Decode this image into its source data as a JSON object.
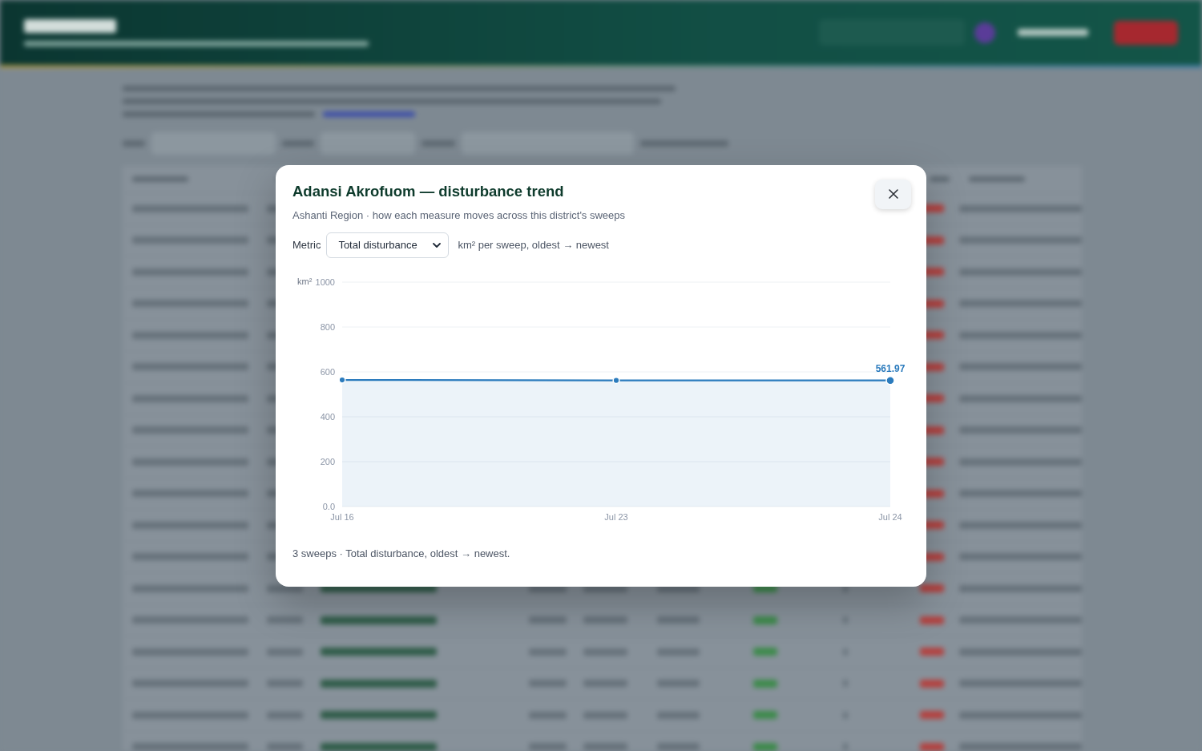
{
  "modal": {
    "title": "Adansi Akrofuom — disturbance trend",
    "subtitle": "Ashanti Region · how each measure moves across this district's sweeps",
    "metric_label": "Metric",
    "metric_select": {
      "value": "Total disturbance"
    },
    "metric_note": "km² per sweep, oldest → newest",
    "chart_data": {
      "type": "area",
      "ylabel": "km²",
      "categories": [
        "Jul 16",
        "Jul 23",
        "Jul 24"
      ],
      "series": [
        {
          "color": "#2b7bbd",
          "values": [
            564,
            562,
            561.97
          ]
        }
      ],
      "ylim": [
        0,
        1000
      ],
      "yticks": [
        {
          "value": 0,
          "label": "0.0"
        },
        200,
        400,
        600,
        800,
        1000
      ],
      "grid": true,
      "annotations": [
        {
          "x": "Jul 24",
          "y": 561.97,
          "text": "561.97"
        }
      ]
    },
    "footer": "3 sweeps · Total disturbance, oldest → newest."
  }
}
